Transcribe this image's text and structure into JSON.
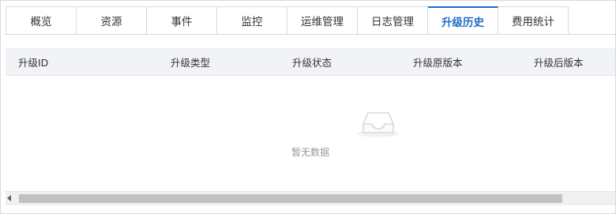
{
  "tabs": [
    {
      "label": "概览"
    },
    {
      "label": "资源"
    },
    {
      "label": "事件"
    },
    {
      "label": "监控"
    },
    {
      "label": "运维管理"
    },
    {
      "label": "日志管理"
    },
    {
      "label": "升级历史"
    },
    {
      "label": "费用统计"
    }
  ],
  "active_tab": "升级历史",
  "table": {
    "columns": [
      "升级ID",
      "升级类型",
      "升级状态",
      "升级原版本",
      "升级后版本"
    ],
    "rows": []
  },
  "empty_state": {
    "text": "暂无数据",
    "icon": "empty-inbox-icon"
  },
  "colors": {
    "accent": "#1d6ec7",
    "header_bg": "#f1f3f6",
    "border": "#d9d9d9",
    "muted_text": "#999999"
  }
}
